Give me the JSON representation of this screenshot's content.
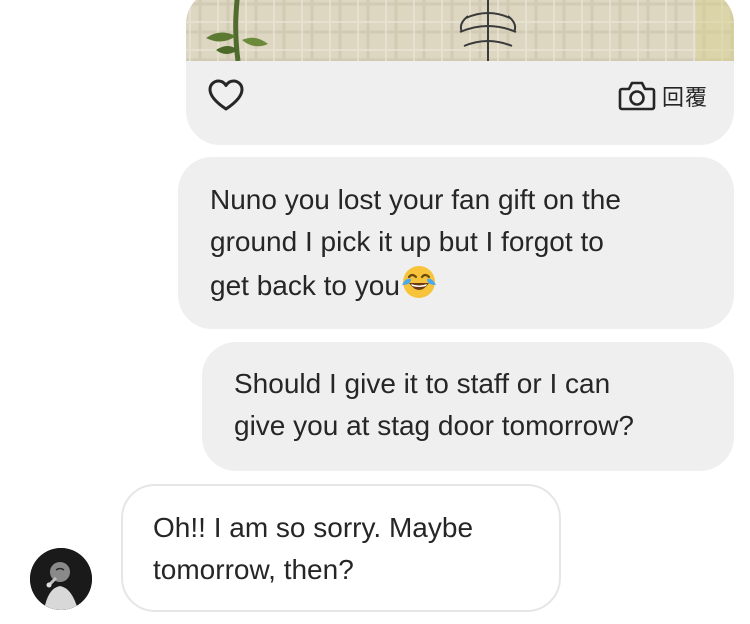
{
  "conversation": {
    "image_message": {
      "reply_label": "回覆",
      "like_icon": "heart-icon",
      "reply_icon": "camera-icon"
    },
    "messages": [
      {
        "sender": "me",
        "lines": [
          "Nuno you lost your fan gift on the",
          "ground I pick it up but I forgot to",
          "get back to you"
        ],
        "emoji": "tears-of-joy"
      },
      {
        "sender": "me",
        "lines": [
          "Should I give it to staff or I can",
          "give you at stag door tomorrow?"
        ]
      },
      {
        "sender": "them",
        "lines": [
          "Oh!! I am so sorry. Maybe",
          "tomorrow, then?"
        ]
      }
    ]
  },
  "colors": {
    "my_bubble": "#efefef",
    "their_bubble_border": "#e6e6e6",
    "text": "#262626",
    "emoji_face": "#f6c33a",
    "emoji_tears": "#4aa8f0"
  }
}
